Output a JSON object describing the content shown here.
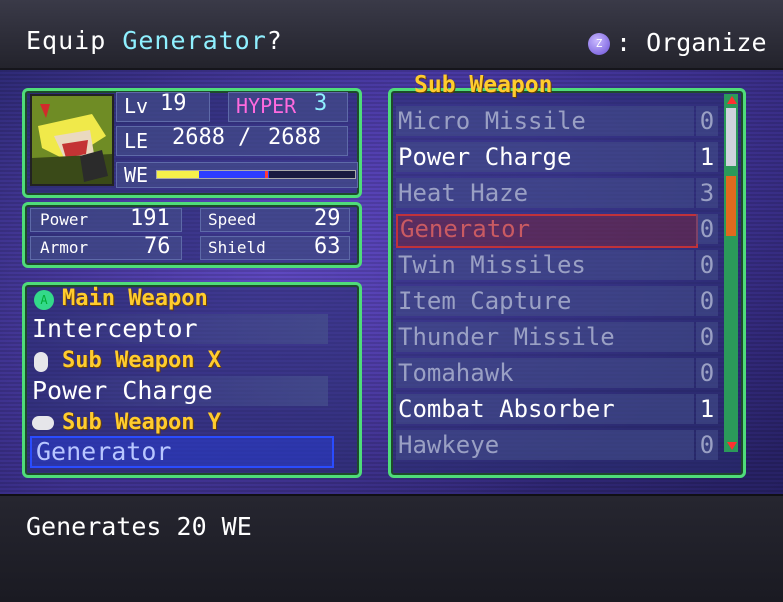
{
  "header": {
    "title_prefix": "Equip ",
    "title_item": "Generator",
    "title_suffix": "?",
    "organize_button": "Z",
    "organize_label": ": Organize"
  },
  "character": {
    "lv_label": "Lv",
    "lv_value": "19",
    "hyper_label": "HYPER",
    "hyper_value": "3",
    "le_label": "LE",
    "le_current": "2688",
    "le_sep": "/",
    "le_max": "2688",
    "we_label": "WE"
  },
  "stats": {
    "power_label": "Power",
    "power": "191",
    "speed_label": "Speed",
    "speed": "29",
    "armor_label": "Armor",
    "armor": "76",
    "shield_label": "Shield",
    "shield": "63"
  },
  "equipment": {
    "main_label": "Main Weapon",
    "main_value": "Interceptor",
    "subx_label": "Sub Weapon X",
    "subx_value": "Power Charge",
    "suby_label": "Sub Weapon Y",
    "suby_value": "Generator"
  },
  "list": {
    "header": "Sub Weapon",
    "items": [
      {
        "name": "Micro Missile",
        "count": "0"
      },
      {
        "name": "Power Charge",
        "count": "1"
      },
      {
        "name": "Heat Haze",
        "count": "3"
      },
      {
        "name": "Generator",
        "count": "0"
      },
      {
        "name": "Twin Missiles",
        "count": "0"
      },
      {
        "name": "Item Capture",
        "count": "0"
      },
      {
        "name": "Thunder Missile",
        "count": "0"
      },
      {
        "name": "Tomahawk",
        "count": "0"
      },
      {
        "name": "Combat Absorber",
        "count": "1"
      },
      {
        "name": "Hawkeye",
        "count": "0"
      }
    ]
  },
  "description": "Generates 20 WE",
  "colors": {
    "panel_border": "#4fdc7a",
    "highlight_cyan": "#8ff0ff",
    "label_gold": "#ffcc2e",
    "selected_blue": "#2a4cff",
    "current_red": "#c0323a"
  }
}
